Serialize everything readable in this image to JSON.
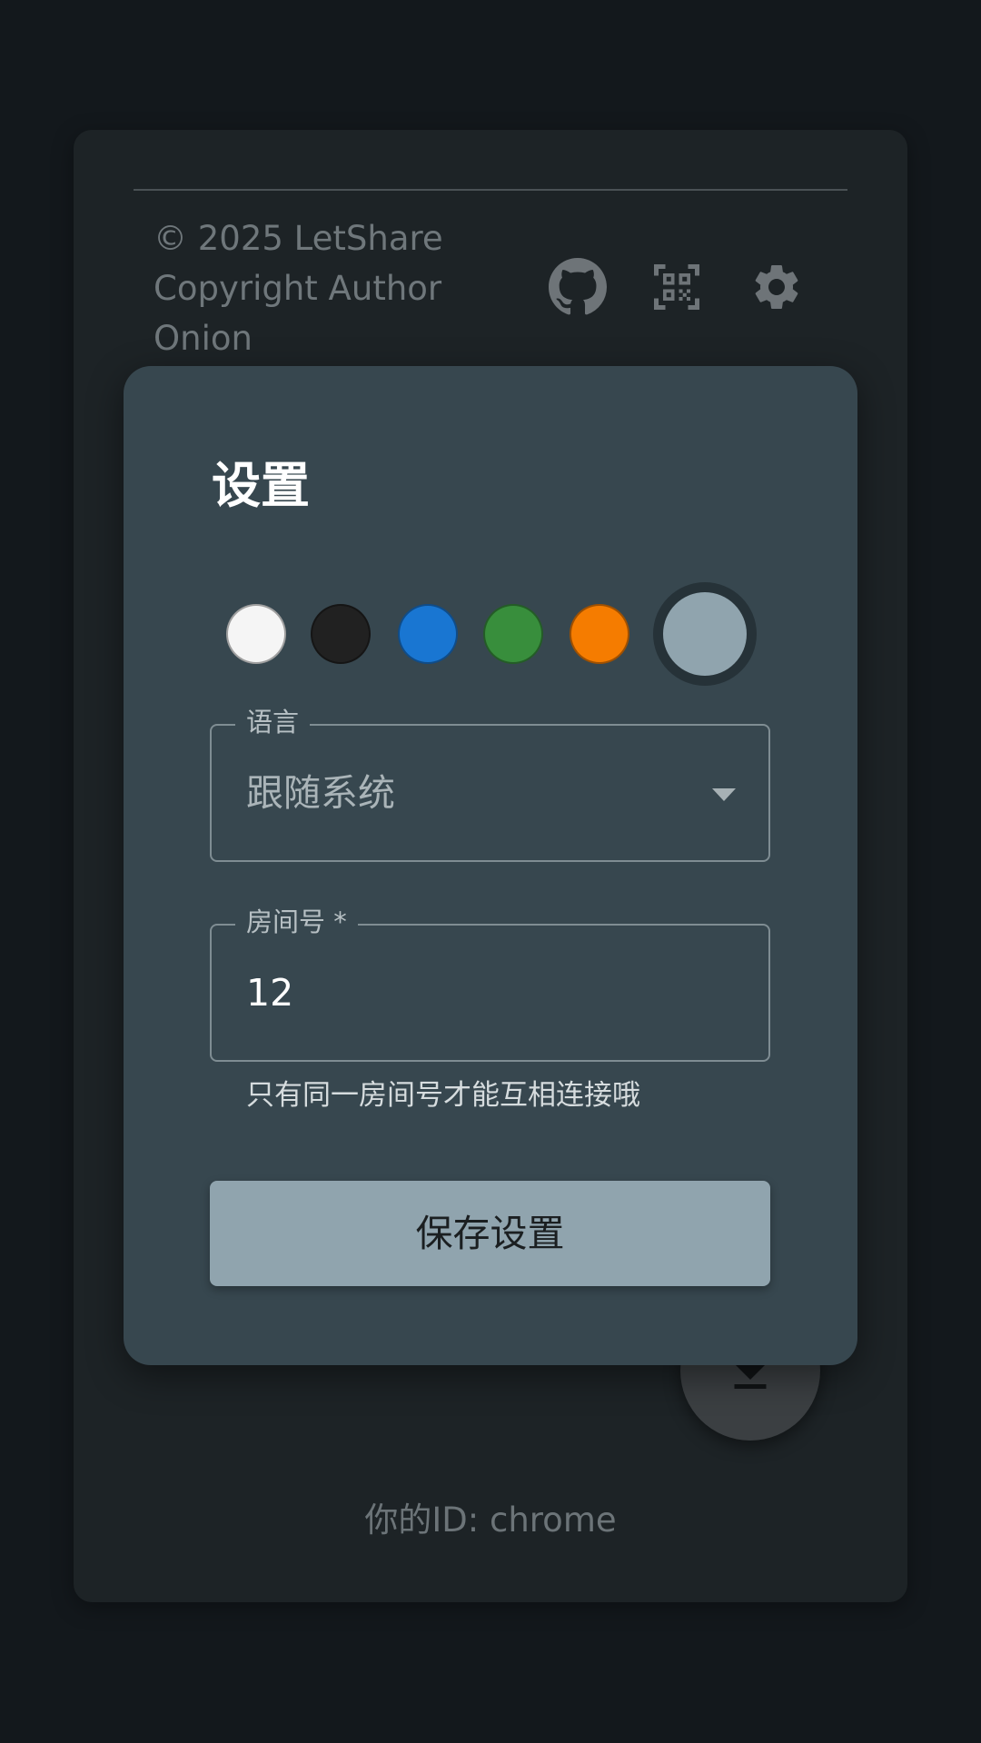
{
  "footer": {
    "copyright_lines": [
      "© 2025 LetShare",
      "Copyright Author",
      "Onion"
    ],
    "icons": [
      "github-icon",
      "qr-code-icon",
      "gear-icon"
    ],
    "user_id_label": "你的ID: chrome"
  },
  "fab": {
    "icon": "download-icon"
  },
  "dialog": {
    "title": "设置",
    "theme_colors": [
      "#f5f5f5",
      "#212121",
      "#1976d2",
      "#388e3c",
      "#f57c00",
      "#90a4ae"
    ],
    "selected_theme_color": "#90a4ae",
    "language": {
      "label": "语言",
      "value": "跟随系统"
    },
    "room": {
      "label": "房间号 *",
      "value": "12",
      "helper": "只有同一房间号才能互相连接哦"
    },
    "save_label": "保存设置"
  }
}
